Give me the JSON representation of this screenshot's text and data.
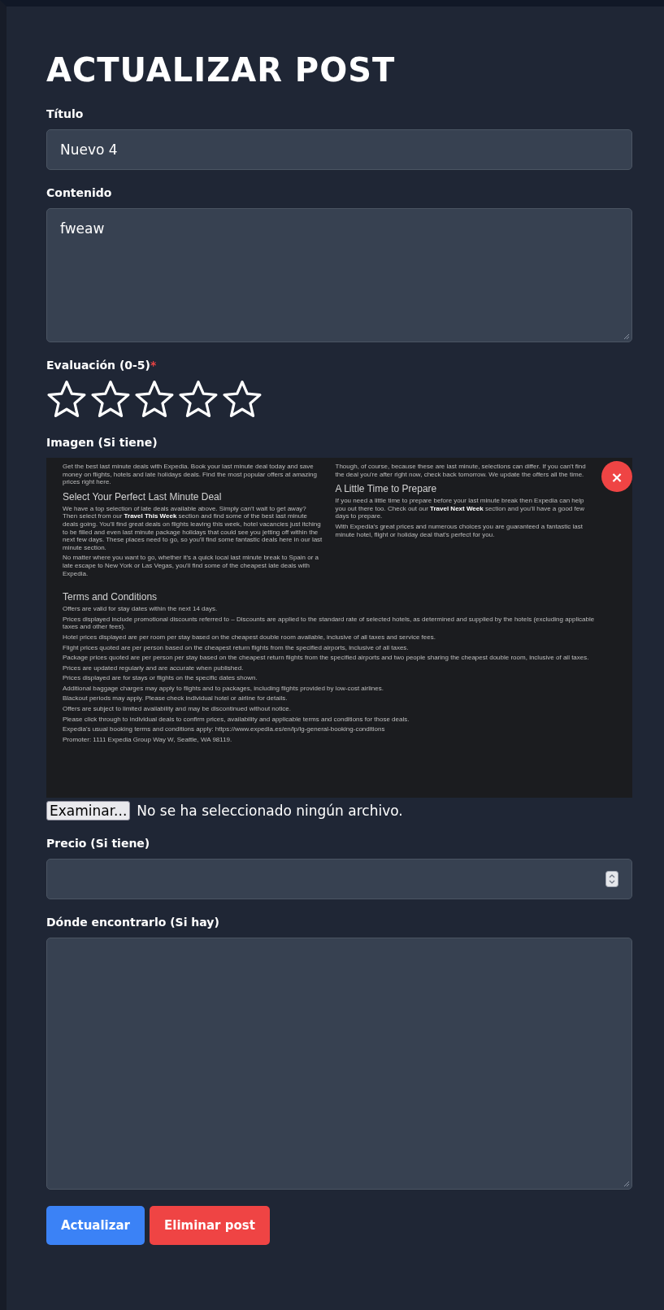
{
  "heading": "ACTUALIZAR POST",
  "fields": [
    {
      "kind": "text",
      "label": "Título",
      "value": "Nuevo 4"
    },
    {
      "kind": "textarea",
      "label": "Contenido",
      "value": "fweaw"
    },
    {
      "kind": "rating",
      "label": "Evaluación (0-5)",
      "required_mark": "*",
      "stars": 0
    },
    {
      "kind": "image",
      "label": "Imagen (Si tiene)",
      "remove": "×",
      "browse": "Examinar...",
      "file_status": "No se ha seleccionado ningún archivo.",
      "preview": {
        "columns": [
          {
            "blocks": [
              {
                "kind": "p",
                "text": "Get the best last minute deals with Expedia. Book your last minute deal today and save money on flights, hotels and late holidays deals. Find the most popular offers at amazing prices right here."
              },
              {
                "kind": "h",
                "text": "Select Your Perfect Last Minute Deal"
              },
              {
                "kind": "p",
                "text": "We have a top selection of late deals available above. Simply can't wait to get away? Then select from our **Travel This Week** section and find some of the best last minute deals going. You'll find great deals on flights leaving this week, hotel vacancies just itching to be filled and even last minute package holidays that could see you jetting off within the next few days. These places need to go, so you'll find some fantastic deals here in our last minute section."
              },
              {
                "kind": "p",
                "text": "No matter where you want to go, whether it's a quick local last minute break to Spain or a late escape to New York or Las Vegas, you'll find some of the cheapest late deals with Expedia."
              }
            ]
          },
          {
            "blocks": [
              {
                "kind": "p",
                "text": "Though, of course, because these are last minute, selections can differ. If you can't find the deal you're after right now, check back tomorrow. We update the offers all the time."
              },
              {
                "kind": "h",
                "text": "A Little Time to Prepare"
              },
              {
                "kind": "p",
                "text": "If you need a little time to prepare before your last minute break then Expedia can help you out there too. Check out our **Travel Next Week** section and you'll have a good few days to prepare."
              },
              {
                "kind": "p",
                "text": "With Expedia's great prices and numerous choices you are guaranteed a fantastic last minute hotel, flight or holiday deal that's perfect for you."
              }
            ]
          }
        ],
        "terms_title": "Terms and Conditions",
        "terms": [
          "Offers are valid for stay dates within the next 14 days.",
          "Prices displayed include promotional discounts referred to – Discounts are applied to the standard rate of selected hotels, as determined and supplied by the hotels (excluding applicable taxes and other fees).",
          "Hotel prices displayed are per room per stay based on the cheapest double room available, inclusive of all taxes and service fees.",
          "Flight prices quoted are per person based on the cheapest return flights from the specified airports, inclusive of all taxes.",
          "Package prices quoted are per person per stay based on the cheapest return flights from the specified airports and two people sharing the cheapest double room, inclusive of all taxes.",
          "Prices are updated regularly and are accurate when published.",
          "Prices displayed are for stays or flights on the specific dates shown.",
          "Additional baggage charges may apply to flights and to packages, including flights provided by low-cost airlines.",
          "Blackout periods may apply. Please check individual hotel or airline for details.",
          "Offers are subject to limited availability and may be discontinued without notice.",
          "Please click through to individual deals to confirm prices, availability and applicable terms and conditions for those deals.",
          "Expedia's usual booking terms and conditions apply: https://www.expedia.es/en/lp/lg-general-booking-conditions",
          "Promoter: 1111 Expedia Group Way W, Seattle, WA 98119."
        ]
      }
    },
    {
      "kind": "number",
      "label": "Precio (Si tiene)"
    },
    {
      "kind": "bigtextarea",
      "label": "Dónde encontrarlo (Si hay)"
    }
  ],
  "buttons": [
    {
      "kind": "primary",
      "label": "Actualizar"
    },
    {
      "kind": "danger",
      "label": "Eliminar post"
    }
  ]
}
